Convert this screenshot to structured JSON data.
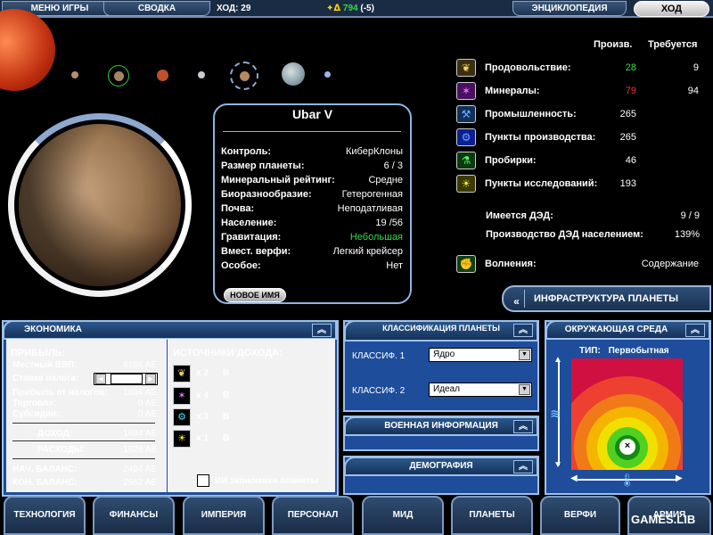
{
  "topbar": {
    "menu_label": "МЕНЮ ИГРЫ",
    "summary_label": "СВОДКА",
    "turn_label": "ХОД: 29",
    "money_value": "794",
    "money_delta": "(-5)",
    "encyclopedia_label": "ЭНЦИКЛОПЕДИЯ",
    "end_turn_label": "ХОД"
  },
  "planet": {
    "name": "Ubar V",
    "rows": [
      {
        "k": "Контроль:",
        "v": "КиберКлоны"
      },
      {
        "k": "Размер планеты:",
        "v": "6 / 3"
      },
      {
        "k": "Минеральный рейтинг:",
        "v": "Средне"
      },
      {
        "k": "Биоразнообразие:",
        "v": "Гетерогенная"
      },
      {
        "k": "Почва:",
        "v": "Неподатливая"
      },
      {
        "k": "Население:",
        "v": "19 /56"
      },
      {
        "k": "Гравитация:",
        "v": "Небольшая"
      },
      {
        "k": "Вмест. верфи:",
        "v": "Легкий крейсер"
      },
      {
        "k": "Особое:",
        "v": "Нет"
      }
    ],
    "rename_label": "НОВОЕ ИМЯ"
  },
  "resources": {
    "col_prod": "Произв.",
    "col_req": "Требуется",
    "rows": [
      {
        "label": "Продовольствие:",
        "prod": "28",
        "req": "9",
        "color": "#33dd44",
        "icon": "wheat-icon"
      },
      {
        "label": "Минералы:",
        "prod": "79",
        "req": "94",
        "color": "#ee3333",
        "icon": "mineral-icon"
      },
      {
        "label": "Промышленность:",
        "prod": "265",
        "req": "",
        "color": "#ffffff",
        "icon": "wrench-icon"
      },
      {
        "label": "Пункты производства:",
        "prod": "265",
        "req": "",
        "color": "#ffffff",
        "icon": "gear-icon"
      },
      {
        "label": "Пробирки:",
        "prod": "46",
        "req": "",
        "color": "#ffffff",
        "icon": "flask-icon"
      },
      {
        "label": "Пункты исследований:",
        "prod": "193",
        "req": "",
        "color": "#ffffff",
        "icon": "bulb-icon"
      }
    ],
    "dad_have_label": "Имеется ДЭД:",
    "dad_have_value": "9 / 9",
    "dad_prod_label": "Производство ДЭД населением:",
    "dad_prod_value": "139%",
    "unrest_label": "Волнения:",
    "unrest_value": "Содержание",
    "infra_label": "ИНФРАСТРУКТУРА ПЛАНЕТЫ"
  },
  "economy": {
    "title": "ЭКОНОМИКА",
    "profit_label": "ПРИБЫЛЬ:",
    "gdp_label": "Местный ВВП:",
    "gdp_value": "6184 AE",
    "tax_label": "Ставка налога:",
    "tax_value": "22%",
    "tax_profit_label": "Прибыль от налогов:",
    "tax_profit_value": "1694 AE",
    "trade_label": "Торговля:",
    "trade_value": "0 AE",
    "subsidy_label": "Субсидии:",
    "subsidy_value": "0 AE",
    "income_label": "ДОХОД:",
    "income_value": "1694 AE",
    "expense_label": "РАСХОДЫ:",
    "expense_value": "1626 AE",
    "start_label": "НАЧ. БАЛАНС:",
    "start_value": "2494 AE",
    "end_label": "КОН. БАЛАНС:",
    "end_value": "2562 AE",
    "sources_label": "ИСТОЧНИКИ ДОХОДА:",
    "sources": [
      {
        "mult": "x 2",
        "tag": "B",
        "icon": "wheat-icon"
      },
      {
        "mult": "x 4",
        "tag": "B",
        "icon": "mineral-icon"
      },
      {
        "mult": "x 3",
        "tag": "B",
        "icon": "gear-icon"
      },
      {
        "mult": "x 1",
        "tag": "B",
        "icon": "bulb-icon"
      }
    ],
    "ai_label": "ИИ экономики планеты"
  },
  "classification": {
    "title": "КЛАССИФИКАЦИЯ ПЛАНЕТЫ",
    "class1_label": "КЛАССИФ. 1",
    "class1_value": "Ядро",
    "class2_label": "КЛАССИФ. 2",
    "class2_value": "Идеал"
  },
  "military_label": "ВОЕННАЯ ИНФОРМАЦИЯ",
  "demography_label": "ДЕМОГРАФИЯ",
  "environment": {
    "title": "ОКРУЖАЮЩАЯ СРЕДА",
    "type_label": "ТИП:",
    "type_value": "Первобытная"
  },
  "nav": [
    "ТЕХНОЛОГИЯ",
    "ФИНАНСЫ",
    "ИМПЕРИЯ",
    "ПЕРСОНАЛ",
    "МИД",
    "ПЛАНЕТЫ",
    "ВЕРФИ",
    "АРМИЯ"
  ],
  "watermark": "GAMES.LIB"
}
